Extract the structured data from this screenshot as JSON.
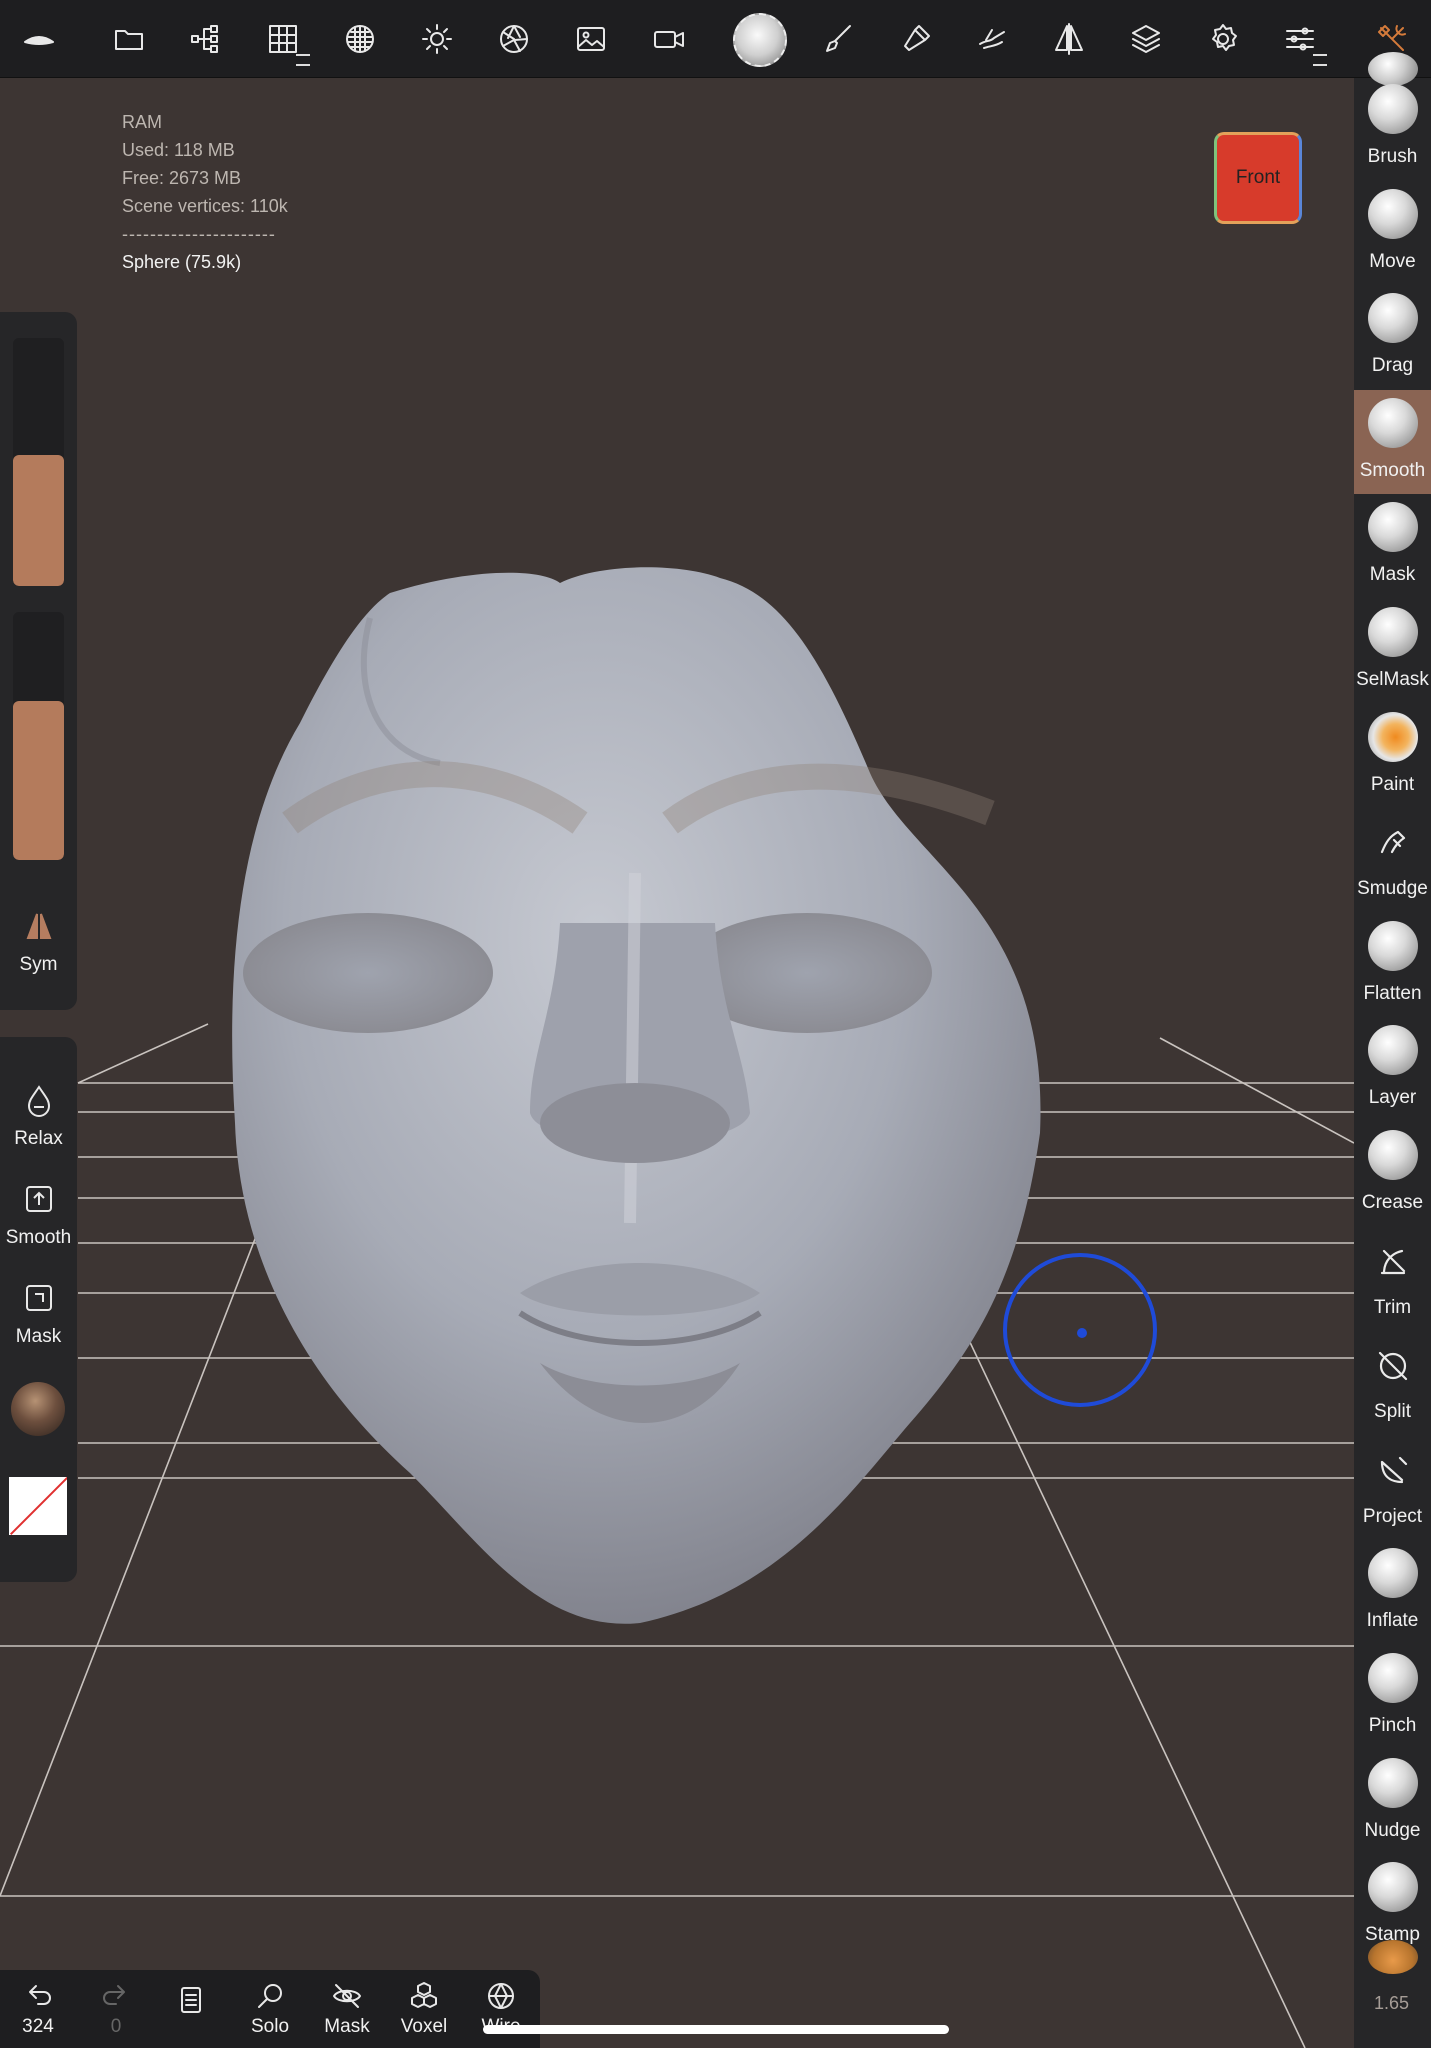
{
  "toolbar": {
    "icons": [
      "menu-logo-icon",
      "folder-icon",
      "scene-tree-icon",
      "topology-grid-icon",
      "multires-icon",
      "light-sun-icon",
      "shading-aperture-icon",
      "image-background-icon",
      "camera-icon",
      "active-tool-smooth-icon",
      "paint-brush-icon",
      "stroke-settings-icon",
      "painting-hand-icon",
      "symmetry-icon",
      "layers-icon",
      "settings-gear-icon",
      "sliders-icon",
      "tools-wrench-icon"
    ]
  },
  "ram": {
    "title": "RAM",
    "used": "Used: 118 MB",
    "free": "Free: 2673 MB",
    "vertices": "Scene vertices: 110k",
    "separator": "----------------------",
    "object": "Sphere (75.9k)"
  },
  "view_cube": {
    "label": "Front"
  },
  "left": {
    "radius_level": 0.53,
    "intensity_level": 0.64,
    "sym_label": "Sym",
    "relax_label": "Relax",
    "smooth_label": "Smooth",
    "mask_label": "Mask"
  },
  "tools": [
    {
      "label": "Brush"
    },
    {
      "label": "Move"
    },
    {
      "label": "Drag"
    },
    {
      "label": "Smooth",
      "selected": true
    },
    {
      "label": "Mask"
    },
    {
      "label": "SelMask"
    },
    {
      "label": "Paint"
    },
    {
      "label": "Smudge"
    },
    {
      "label": "Flatten"
    },
    {
      "label": "Layer"
    },
    {
      "label": "Crease"
    },
    {
      "label": "Trim"
    },
    {
      "label": "Split"
    },
    {
      "label": "Project"
    },
    {
      "label": "Inflate"
    },
    {
      "label": "Pinch"
    },
    {
      "label": "Nudge"
    },
    {
      "label": "Stamp"
    }
  ],
  "bottom": {
    "undo_count": "324",
    "redo_count": "0",
    "solo": "Solo",
    "mask": "Mask",
    "voxel": "Voxel",
    "wire": "Wire"
  },
  "version": "1.65",
  "colors": {
    "accent_selected": "#8a6453",
    "slider_fill": "#b47b5c",
    "cursor": "#1f4bd8",
    "view_cube": "#d73b2b"
  }
}
